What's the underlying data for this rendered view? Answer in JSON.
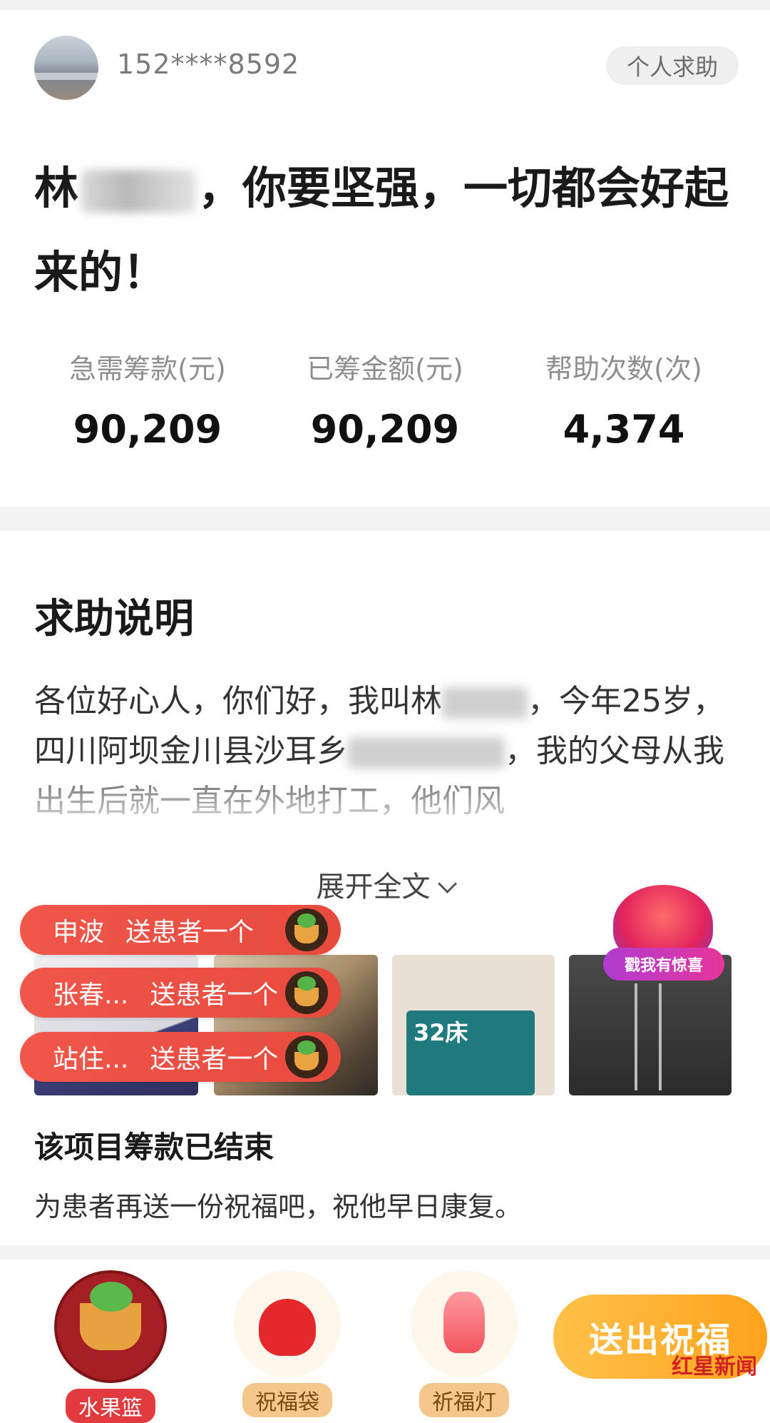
{
  "header": {
    "username": "152****8592",
    "tag": "个人求助"
  },
  "title": {
    "prefix": "林",
    "suffix": "，你要坚强，一切都会好起来的！"
  },
  "stats": [
    {
      "label": "急需筹款(元)",
      "value": "90,209"
    },
    {
      "label": "已筹金额(元)",
      "value": "90,209"
    },
    {
      "label": "帮助次数(次)",
      "value": "4,374"
    }
  ],
  "section": {
    "title": "求助说明",
    "desc_1": "各位好心人，你们好，我叫林",
    "desc_2": "，今年25岁，四川阿坝金川县沙耳乡",
    "desc_3": "，我的父母从我出生后就一直在外地打工，他们风",
    "expand_label": "展开全文"
  },
  "donations": [
    {
      "sender": "申波",
      "action": "送患者一个"
    },
    {
      "sender": "张春...",
      "action": "送患者一个"
    },
    {
      "sender": "站住...",
      "action": "送患者一个"
    }
  ],
  "photos": {
    "bed_label": "32床"
  },
  "promo": {
    "label": "戳我有惊喜"
  },
  "ended": {
    "title": "该项目筹款已结束",
    "subtitle": "为患者再送一份祝福吧，祝他早日康复。"
  },
  "gifts": [
    {
      "label": "水果篮",
      "icon": "fruit-basket-icon"
    },
    {
      "label": "祝福袋",
      "icon": "lucky-bag-icon"
    },
    {
      "label": "祈福灯",
      "icon": "sky-lantern-icon"
    }
  ],
  "send_button": "送出祝福",
  "watermark": "红星新闻",
  "colors": {
    "accent_red": "#e84a3e",
    "accent_orange": "#ffa21c"
  }
}
